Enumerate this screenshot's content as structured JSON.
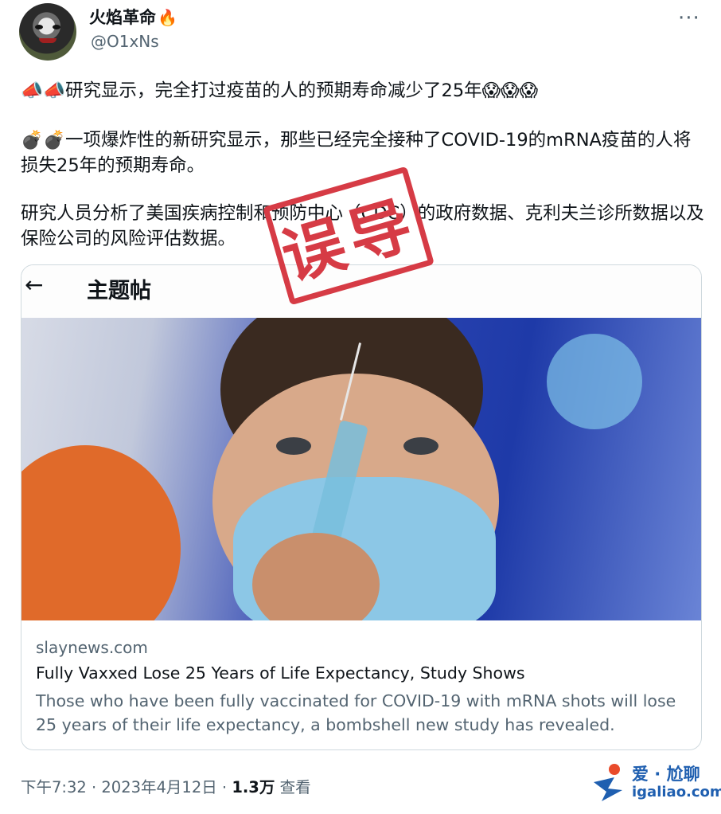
{
  "user": {
    "name": "火焰革命",
    "name_emoji": "🔥",
    "handle": "@O1xNs"
  },
  "tweet": {
    "p1": "📣📣研究显示，完全打过疫苗的人的预期寿命减少了25年😱😱😱",
    "p2": "💣💣一项爆炸性的新研究显示，那些已经完全接种了COVID-19的mRNA疫苗的人将损失25年的预期寿命。",
    "p3": "研究人员分析了美国疾病控制和预防中心（CDC）的政府数据、克利夫兰诊所数据以及保险公司的风险评估数据。"
  },
  "card": {
    "header_title": "主题帖",
    "back_icon": "←",
    "domain": "slaynews.com",
    "title": "Fully Vaxxed Lose 25 Years of Life Expectancy, Study Shows",
    "description": "Those who have been fully vaccinated for COVID-19 with mRNA shots will lose 25 years of their life expectancy, a bombshell new study has revealed."
  },
  "stamp": {
    "text": "误导",
    "color": "#d63b45"
  },
  "meta": {
    "time_date": "下午7:32 · 2023年4月12日 · ",
    "views": "1.3万",
    "views_label": " 查看"
  },
  "more_icon": "···",
  "watermark": {
    "cn": "爱 · 尬聊",
    "en": "igaliao.com"
  },
  "colors": {
    "text": "#0f1419",
    "secondary": "#536471",
    "border": "#cfd9de"
  }
}
